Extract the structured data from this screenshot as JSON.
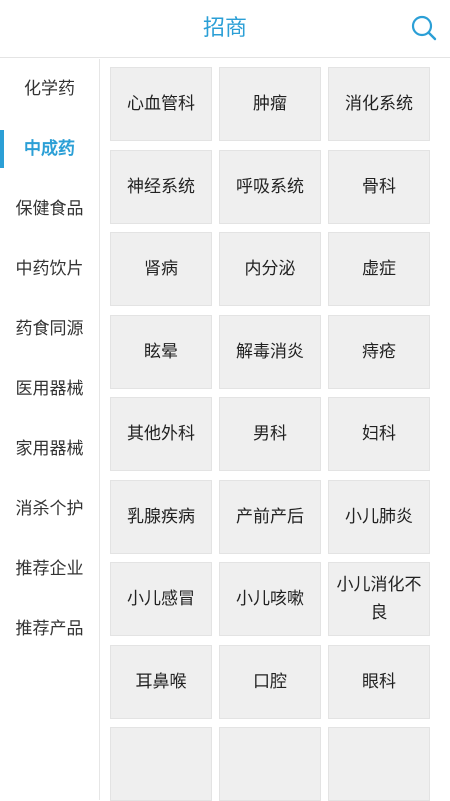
{
  "header": {
    "title": "招商",
    "search_icon": "search-icon"
  },
  "accent_color": "#2b9fd6",
  "sidebar": {
    "active_index": 1,
    "items": [
      {
        "label": "化学药"
      },
      {
        "label": "中成药"
      },
      {
        "label": "保健食品"
      },
      {
        "label": "中药饮片"
      },
      {
        "label": "药食同源"
      },
      {
        "label": "医用器械"
      },
      {
        "label": "家用器械"
      },
      {
        "label": "消杀个护"
      },
      {
        "label": "推荐企业"
      },
      {
        "label": "推荐产品"
      }
    ]
  },
  "categories": [
    {
      "label": "心血管科"
    },
    {
      "label": "肿瘤"
    },
    {
      "label": "消化系统"
    },
    {
      "label": "神经系统"
    },
    {
      "label": "呼吸系统"
    },
    {
      "label": "骨科"
    },
    {
      "label": "肾病"
    },
    {
      "label": "内分泌"
    },
    {
      "label": "虚症"
    },
    {
      "label": "眩晕"
    },
    {
      "label": "解毒消炎"
    },
    {
      "label": "痔疮"
    },
    {
      "label": "其他外科"
    },
    {
      "label": "男科"
    },
    {
      "label": "妇科"
    },
    {
      "label": "乳腺疾病"
    },
    {
      "label": "产前产后"
    },
    {
      "label": "小儿肺炎"
    },
    {
      "label": "小儿感冒"
    },
    {
      "label": "小儿咳嗽"
    },
    {
      "label": "小儿消化不良"
    },
    {
      "label": "耳鼻喉"
    },
    {
      "label": "口腔"
    },
    {
      "label": "眼科"
    },
    {
      "label": ""
    },
    {
      "label": ""
    },
    {
      "label": ""
    }
  ]
}
